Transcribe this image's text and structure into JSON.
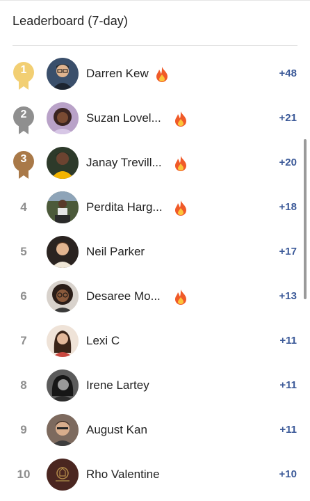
{
  "header": {
    "title": "Leaderboard (7-day)"
  },
  "colors": {
    "gold": "#f2cf73",
    "silver": "#8f8f8f",
    "bronze": "#a97948",
    "score": "#3b5998",
    "fire": "#f05a28"
  },
  "entries": [
    {
      "rank": "1",
      "name": "Darren Kew",
      "score": "+48",
      "fire": true
    },
    {
      "rank": "2",
      "name": "Suzan Lovel...",
      "score": "+21",
      "fire": true
    },
    {
      "rank": "3",
      "name": "Janay Trevill...",
      "score": "+20",
      "fire": true
    },
    {
      "rank": "4",
      "name": "Perdita Harg...",
      "score": "+18",
      "fire": true
    },
    {
      "rank": "5",
      "name": "Neil Parker",
      "score": "+17",
      "fire": false
    },
    {
      "rank": "6",
      "name": "Desaree Mo...",
      "score": "+13",
      "fire": true
    },
    {
      "rank": "7",
      "name": "Lexi C",
      "score": "+11",
      "fire": false
    },
    {
      "rank": "8",
      "name": "Irene Lartey",
      "score": "+11",
      "fire": false
    },
    {
      "rank": "9",
      "name": "August Kan",
      "score": "+11",
      "fire": false
    },
    {
      "rank": "10",
      "name": "Rho Valentine",
      "score": "+10",
      "fire": false
    }
  ]
}
